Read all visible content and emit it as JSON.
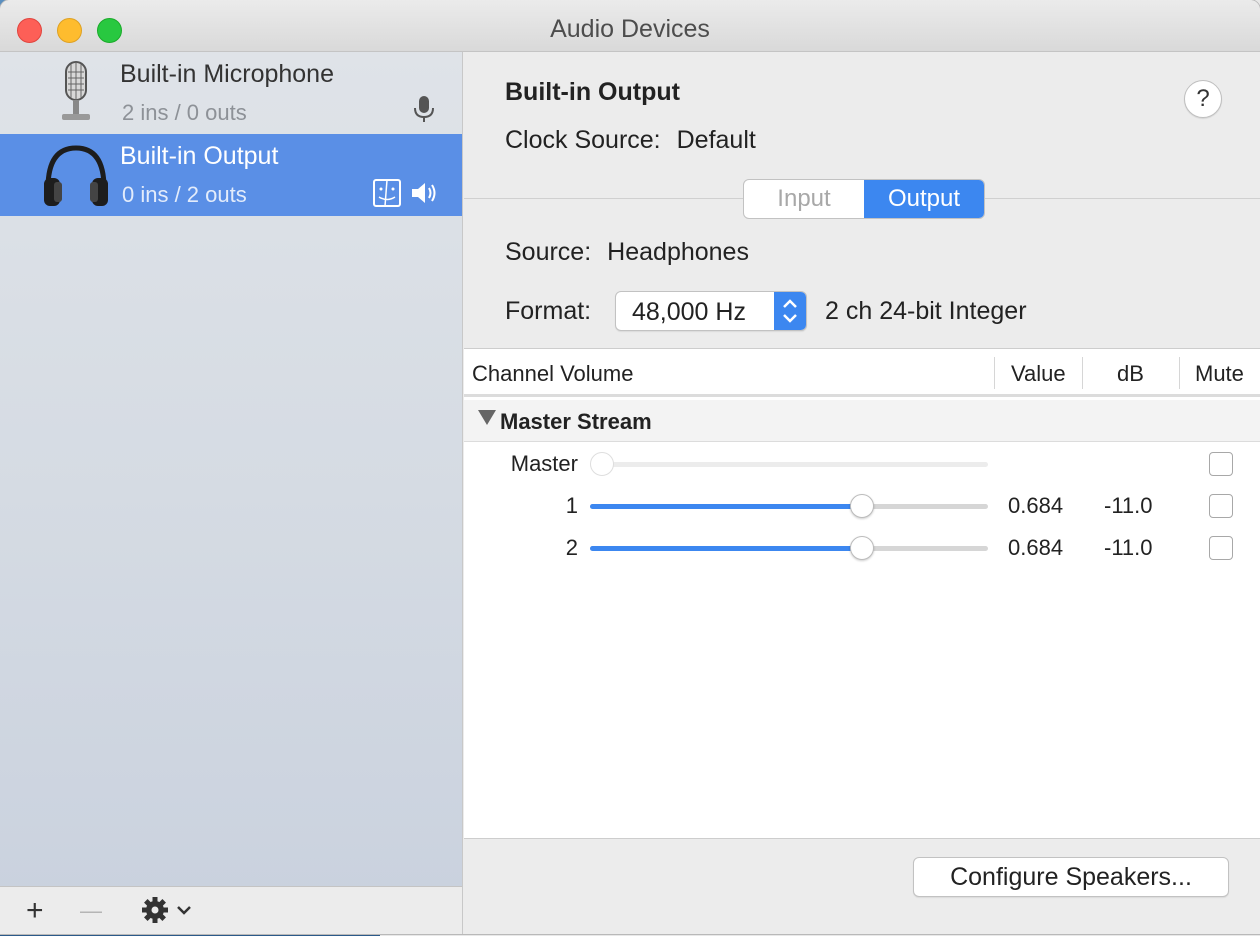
{
  "window": {
    "title": "Audio Devices"
  },
  "sidebar": {
    "devices": [
      {
        "name": "Built-in Microphone",
        "io": "2 ins / 0 outs",
        "icon": "microphone-icon",
        "selected": false
      },
      {
        "name": "Built-in Output",
        "io": "0 ins / 2 outs",
        "icon": "headphones-icon",
        "selected": true
      }
    ],
    "bottom": {
      "add_label": "+",
      "remove_label": "—"
    }
  },
  "detail": {
    "title": "Built-in Output",
    "help_label": "?",
    "clock_label": "Clock Source:",
    "clock_value": "Default",
    "tabs": [
      {
        "label": "Input",
        "active": false
      },
      {
        "label": "Output",
        "active": true
      }
    ],
    "source_label": "Source:",
    "source_value": "Headphones",
    "format_label": "Format:",
    "format_value": "48,000 Hz",
    "format_desc": "2 ch 24-bit Integer",
    "table": {
      "headers": [
        "Channel Volume",
        "Value",
        "dB",
        "Mute"
      ],
      "group": "Master Stream",
      "rows": [
        {
          "label": "Master",
          "level": 0.0,
          "value": "",
          "db": "",
          "muted": false,
          "enabled": false
        },
        {
          "label": "1",
          "level": 0.684,
          "value": "0.684",
          "db": "-11.0",
          "muted": false,
          "enabled": true
        },
        {
          "label": "2",
          "level": 0.684,
          "value": "0.684",
          "db": "-11.0",
          "muted": false,
          "enabled": true
        }
      ]
    },
    "configure_label": "Configure Speakers..."
  },
  "colors": {
    "accent": "#3c87f0",
    "selection": "#5a8fe6"
  }
}
